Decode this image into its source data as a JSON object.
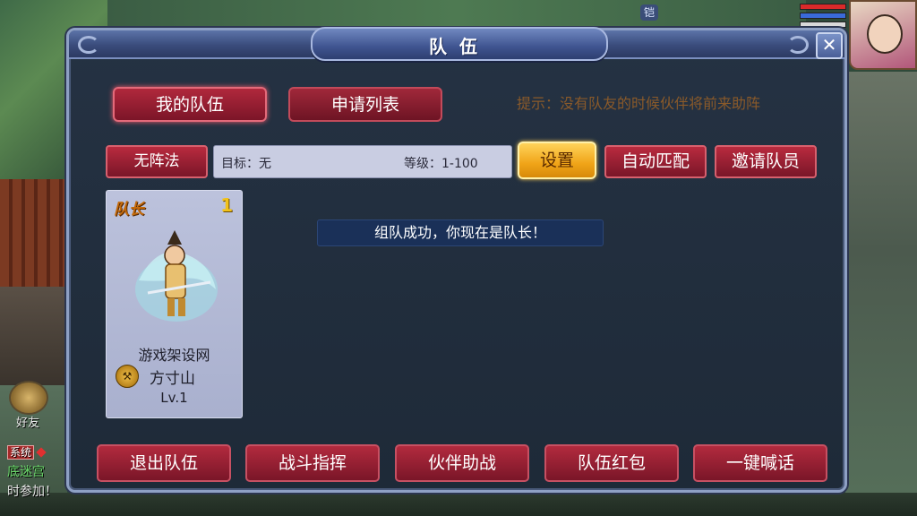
{
  "hud": {
    "top_icon": "铠",
    "friends_label": "好友",
    "chat": {
      "tag": "系统",
      "line1": "底迷宫",
      "line2": "时参加！"
    }
  },
  "dialog": {
    "title": "队伍",
    "close_label": "✕",
    "tabs": [
      {
        "label": "我的队伍",
        "active": true
      },
      {
        "label": "申请列表",
        "active": false
      }
    ],
    "hint": "提示：没有队友的时候伙伴将前来助阵",
    "toolbar": {
      "formation_label": "无阵法",
      "target_text": "目标：无",
      "level_text": "等级：1-100",
      "settings_label": "设置",
      "automatch_label": "自动匹配",
      "invite_label": "邀请队员"
    },
    "member": {
      "role": "队长",
      "slot": "1",
      "name": "游戏架设网",
      "school": "方寸山",
      "level": "Lv.1"
    },
    "status_message": "组队成功，你现在是队长！",
    "bottom_buttons": [
      "退出队伍",
      "战斗指挥",
      "伙伴助战",
      "队伍红包",
      "一键喊话"
    ]
  },
  "colors": {
    "dialog_bg": "#1e2a38",
    "title_bar": "#3a4c7c",
    "button_red": "#9a2034",
    "button_gold": "#f0a418",
    "hint_text": "#8a5a2a",
    "status_bg": "#1a3058"
  },
  "icons": {
    "close": "close-icon",
    "school": "fangcun-school-icon",
    "friends": "handshake-icon"
  }
}
